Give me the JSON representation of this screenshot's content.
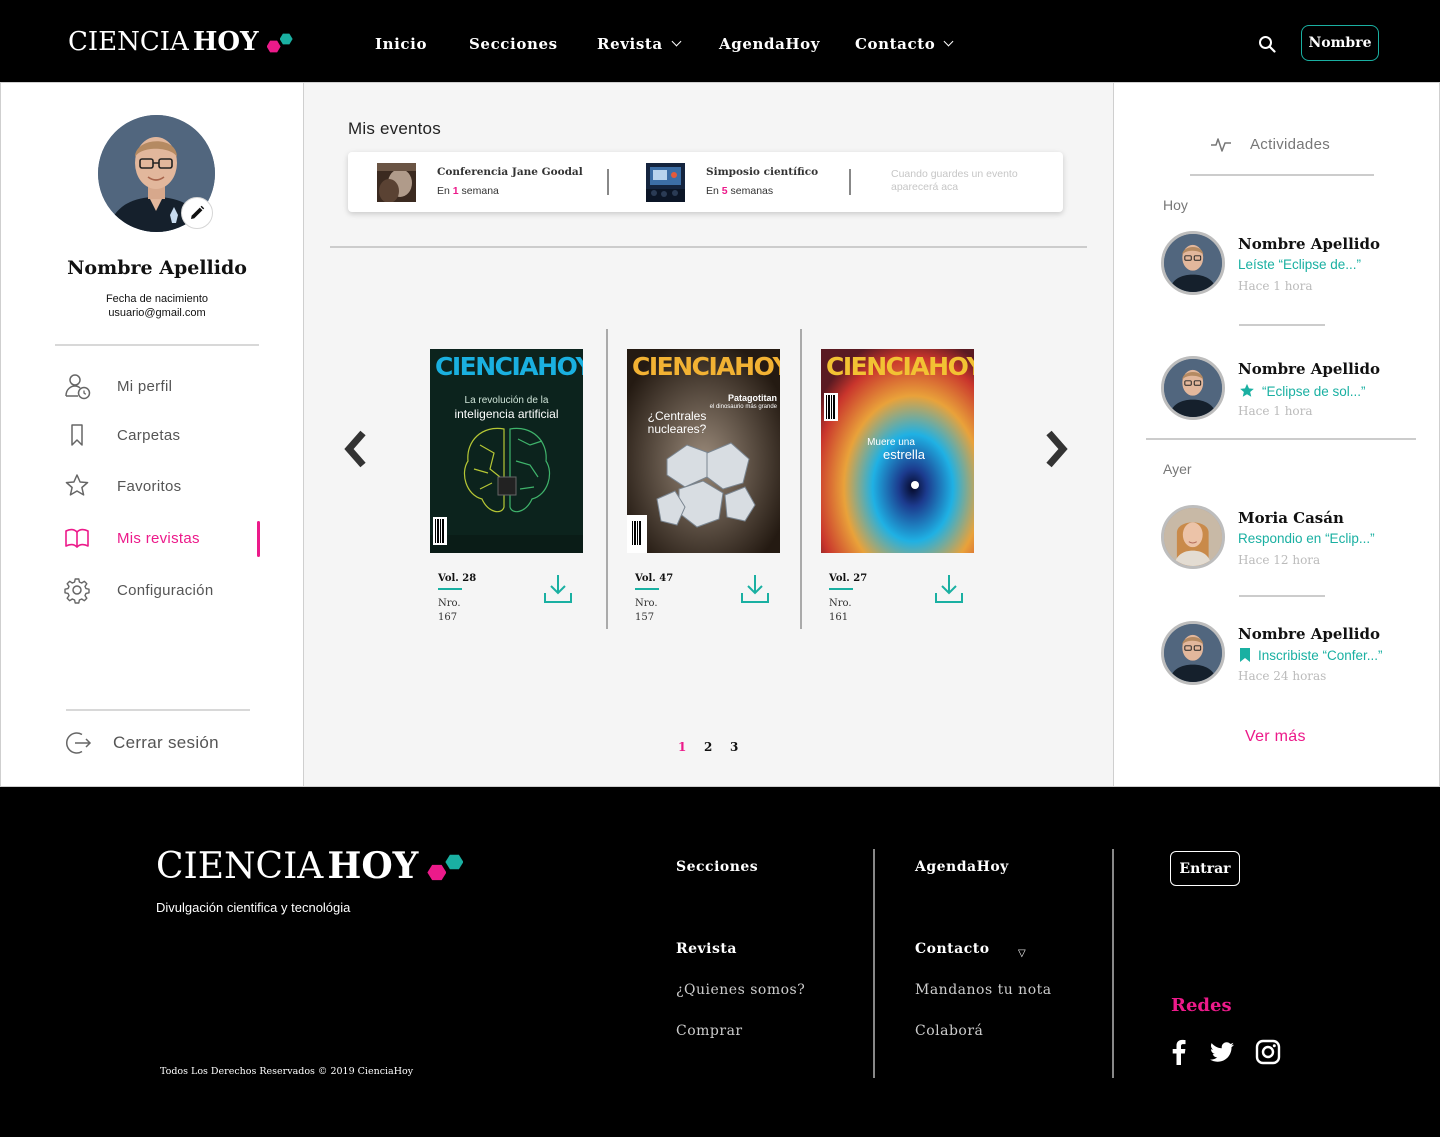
{
  "brand": {
    "word1": "CIENCIA",
    "word2": "HOY",
    "pink": "#ec1a8a",
    "teal": "#1ab0a2"
  },
  "nav": {
    "items": [
      {
        "label": "Inicio",
        "dropdown": false
      },
      {
        "label": "Secciones",
        "dropdown": false
      },
      {
        "label": "Revista",
        "dropdown": true
      },
      {
        "label": "AgendaHoy",
        "dropdown": false
      },
      {
        "label": "Contacto",
        "dropdown": true
      }
    ],
    "search_icon": "search-icon",
    "user_button": "Nombre"
  },
  "profile": {
    "name": "Nombre Apellido",
    "birthdate": "Fecha de nacimiento",
    "email": "usuario@gmail.com",
    "edit_icon": "pencil-icon"
  },
  "menu": {
    "items": [
      {
        "label": "Mi perfil",
        "icon": "user-clock-icon",
        "active": false
      },
      {
        "label": "Carpetas",
        "icon": "bookmark-icon",
        "active": false
      },
      {
        "label": "Favoritos",
        "icon": "star-icon",
        "active": false
      },
      {
        "label": "Mis revistas",
        "icon": "open-book-icon",
        "active": true
      },
      {
        "label": "Configuración",
        "icon": "gear-icon",
        "active": false
      }
    ],
    "logout": "Cerrar sesión"
  },
  "events": {
    "title": "Mis eventos",
    "items": [
      {
        "title": "Conferencia Jane Goodal",
        "prefix": "En",
        "count": "1",
        "unit": "semana"
      },
      {
        "title": "Simposio científico",
        "prefix": "En",
        "count": "5",
        "unit": "semanas"
      }
    ],
    "empty_hint": "Cuando guardes un evento aparecerá aca"
  },
  "magazines": {
    "items": [
      {
        "vol": "Vol. 28",
        "nro_label": "Nro.",
        "nro": "167",
        "headline1": "La revolución de la",
        "headline2": "inteligencia artificial",
        "logo_color": "#1ab0e0"
      },
      {
        "vol": "Vol. 47",
        "nro_label": "Nro.",
        "nro": "157",
        "headline1": "¿Centrales",
        "headline2": "nucleares?",
        "sub1": "Patagotitan",
        "sub2": "el dinosaurio más grande",
        "logo_color": "#f2b233"
      },
      {
        "vol": "Vol. 27",
        "nro_label": "Nro.",
        "nro": "161",
        "headline1": "Muere una",
        "headline2": "estrella",
        "logo_color": "#f2c233"
      }
    ],
    "pagination": [
      "1",
      "2",
      "3"
    ],
    "current_page": "1"
  },
  "activity": {
    "header": "Actividades",
    "days": [
      {
        "label": "Hoy"
      },
      {
        "label": "Ayer"
      }
    ],
    "items": [
      {
        "name": "Nombre Apellido",
        "text": "Leíste “Eclipse de...”",
        "icon": "",
        "time": "Hace 1 hora"
      },
      {
        "name": "Nombre Apellido",
        "text": "“Eclipse de sol...”",
        "icon": "star-icon",
        "time": "Hace 1 hora"
      },
      {
        "name": "Moria Casán",
        "text": "Respondio en “Eclip...”",
        "icon": "",
        "time": "Hace 12 hora"
      },
      {
        "name": "Nombre Apellido",
        "text": "Inscribiste “Confer...”",
        "icon": "bookmark-icon",
        "time": "Hace 24 horas"
      }
    ],
    "more": "Ver más"
  },
  "footer": {
    "tagline": "Divulgación cientifica y tecnológia",
    "copyright": "Todos Los Derechos Reservados © 2019 CienciaHoy",
    "col1": {
      "head1": "Secciones",
      "head2": "Revista",
      "links": [
        "¿Quienes somos?",
        "Comprar"
      ]
    },
    "col2": {
      "head1": "AgendaHoy",
      "head2": "Contacto",
      "links": [
        "Mandanos tu nota",
        "Colaborá"
      ]
    },
    "enter_button": "Entrar",
    "social_title": "Redes",
    "social": [
      "facebook-icon",
      "twitter-icon",
      "instagram-icon"
    ]
  }
}
